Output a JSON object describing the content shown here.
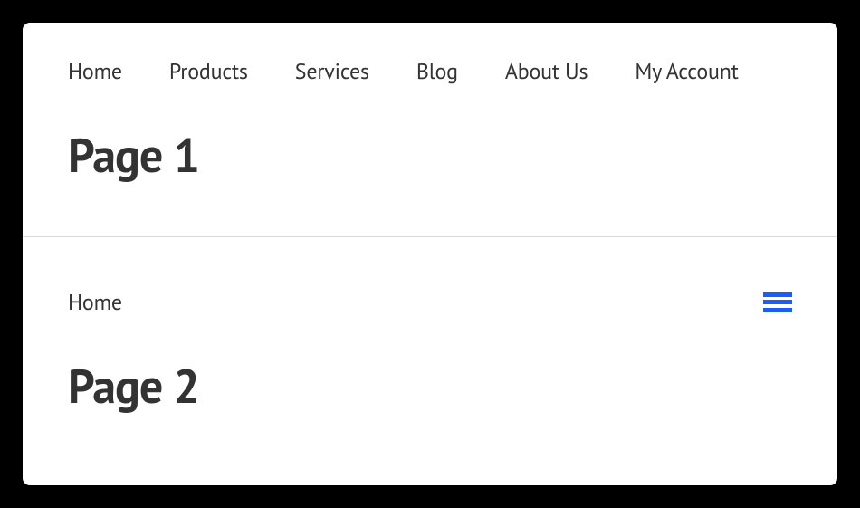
{
  "page1": {
    "nav": [
      {
        "label": "Home"
      },
      {
        "label": "Products"
      },
      {
        "label": "Services"
      },
      {
        "label": "Blog"
      },
      {
        "label": "About Us"
      },
      {
        "label": "My Account"
      }
    ],
    "title": "Page 1"
  },
  "page2": {
    "nav": [
      {
        "label": "Home"
      }
    ],
    "title": "Page 2"
  }
}
